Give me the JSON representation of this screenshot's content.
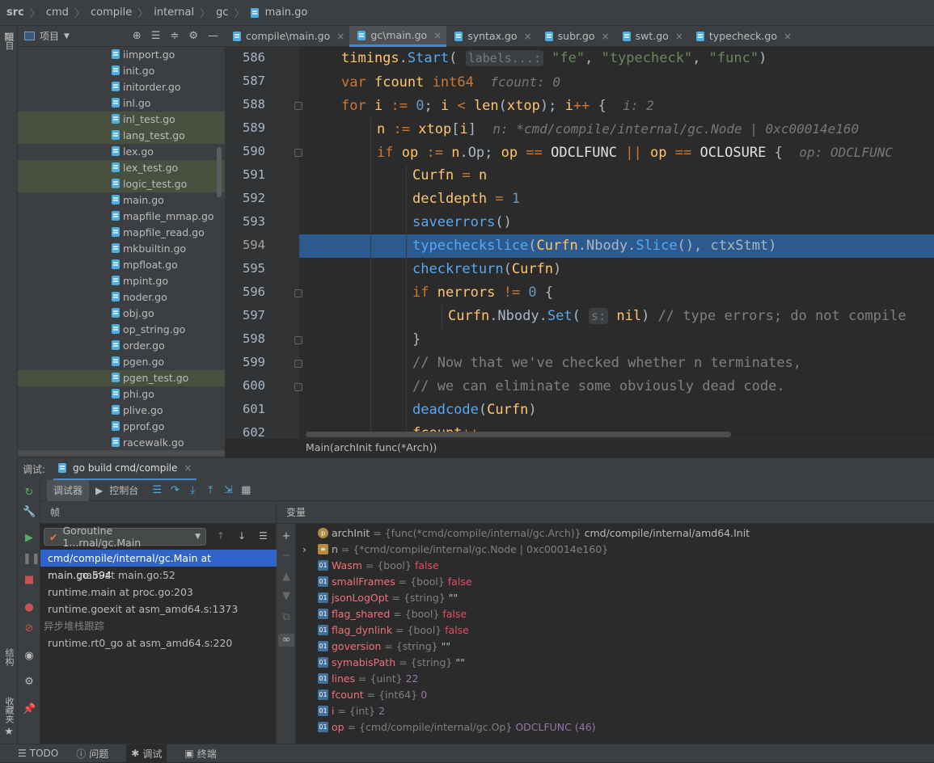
{
  "breadcrumb": [
    "src",
    "cmd",
    "compile",
    "internal",
    "gc",
    "main.go"
  ],
  "left_strip": {
    "project": "项目",
    "structure": "结构",
    "favorites": "收藏夹"
  },
  "project_panel": {
    "title": "项目",
    "files": [
      {
        "name": "iimport.go",
        "highlight": false
      },
      {
        "name": "init.go",
        "highlight": false
      },
      {
        "name": "initorder.go",
        "highlight": false
      },
      {
        "name": "inl.go",
        "highlight": false
      },
      {
        "name": "inl_test.go",
        "highlight": true
      },
      {
        "name": "lang_test.go",
        "highlight": true
      },
      {
        "name": "lex.go",
        "highlight": false
      },
      {
        "name": "lex_test.go",
        "highlight": true
      },
      {
        "name": "logic_test.go",
        "highlight": true
      },
      {
        "name": "main.go",
        "highlight": false
      },
      {
        "name": "mapfile_mmap.go",
        "highlight": false
      },
      {
        "name": "mapfile_read.go",
        "highlight": false
      },
      {
        "name": "mkbuiltin.go",
        "highlight": false
      },
      {
        "name": "mpfloat.go",
        "highlight": false
      },
      {
        "name": "mpint.go",
        "highlight": false
      },
      {
        "name": "noder.go",
        "highlight": false
      },
      {
        "name": "obj.go",
        "highlight": false
      },
      {
        "name": "op_string.go",
        "highlight": false
      },
      {
        "name": "order.go",
        "highlight": false
      },
      {
        "name": "pgen.go",
        "highlight": false
      },
      {
        "name": "pgen_test.go",
        "highlight": true
      },
      {
        "name": "phi.go",
        "highlight": false
      },
      {
        "name": "plive.go",
        "highlight": false
      },
      {
        "name": "pprof.go",
        "highlight": false
      },
      {
        "name": "racewalk.go",
        "highlight": false
      }
    ]
  },
  "tabs": [
    {
      "label": "compile\\main.go",
      "active": false
    },
    {
      "label": "gc\\main.go",
      "active": true
    },
    {
      "label": "syntax.go",
      "active": false
    },
    {
      "label": "subr.go",
      "active": false
    },
    {
      "label": "swt.go",
      "active": false
    },
    {
      "label": "typecheck.go",
      "active": false
    }
  ],
  "code": {
    "line_numbers": [
      "586",
      "587",
      "588",
      "589",
      "590",
      "591",
      "592",
      "593",
      "594",
      "595",
      "596",
      "597",
      "598",
      "599",
      "600",
      "601",
      "602"
    ],
    "current_line": "594",
    "hints": {
      "labels": "labels...:",
      "fcount": "fcount: 0",
      "i": "i: 2",
      "n": "n: *cmd/compile/internal/gc.Node | 0xc00014e160",
      "op": "op: ODCLFUNC",
      "s": "s:"
    },
    "footer": "Main(archInit func(*Arch))"
  },
  "debug": {
    "label": "调试:",
    "session": "go build cmd/compile",
    "tab_debugger": "调试器",
    "tab_console": "控制台",
    "frames_header": "帧",
    "goroutine": "Goroutine 1...rnal/gc.Main",
    "frames": [
      {
        "text": "cmd/compile/internal/gc.Main at main.go:594",
        "selected": true,
        "group": false
      },
      {
        "text": "main.main at main.go:52",
        "selected": false,
        "group": false
      },
      {
        "text": "runtime.main at proc.go:203",
        "selected": false,
        "group": false
      },
      {
        "text": "runtime.goexit at asm_amd64.s:1373",
        "selected": false,
        "group": false
      },
      {
        "text": "异步堆栈跟踪",
        "selected": false,
        "group": true
      },
      {
        "text": "runtime.rt0_go at asm_amd64.s:220",
        "selected": false,
        "group": false
      }
    ],
    "variables_header": "变量",
    "variables": [
      {
        "badge": "p",
        "name": "archInit",
        "type": "{func(*cmd/compile/internal/gc.Arch)}",
        "value": "cmd/compile/internal/amd64.Init",
        "kind": "norm",
        "expand": false
      },
      {
        "badge": "n",
        "name": "n",
        "type": "{*cmd/compile/internal/gc.Node | 0xc00014e160}",
        "value": "",
        "kind": "norm",
        "expand": true
      },
      {
        "badge": "o",
        "name": "Wasm",
        "type": "{bool}",
        "value": "false",
        "kind": "bool",
        "expand": false
      },
      {
        "badge": "o",
        "name": "smallFrames",
        "type": "{bool}",
        "value": "false",
        "kind": "bool",
        "expand": false
      },
      {
        "badge": "o",
        "name": "jsonLogOpt",
        "type": "{string}",
        "value": "\"\"",
        "kind": "str",
        "expand": false
      },
      {
        "badge": "o",
        "name": "flag_shared",
        "type": "{bool}",
        "value": "false",
        "kind": "bool",
        "expand": false
      },
      {
        "badge": "o",
        "name": "flag_dynlink",
        "type": "{bool}",
        "value": "false",
        "kind": "bool",
        "expand": false
      },
      {
        "badge": "o",
        "name": "goversion",
        "type": "{string}",
        "value": "\"\"",
        "kind": "str",
        "expand": false
      },
      {
        "badge": "o",
        "name": "symabisPath",
        "type": "{string}",
        "value": "\"\"",
        "kind": "str",
        "expand": false
      },
      {
        "badge": "o",
        "name": "lines",
        "type": "{uint}",
        "value": "22",
        "kind": "num",
        "expand": false
      },
      {
        "badge": "o",
        "name": "fcount",
        "type": "{int64}",
        "value": "0",
        "kind": "num",
        "expand": false
      },
      {
        "badge": "o",
        "name": "i",
        "type": "{int}",
        "value": "2",
        "kind": "num",
        "expand": false
      },
      {
        "badge": "o",
        "name": "op",
        "type": "{cmd/compile/internal/gc.Op}",
        "value": "ODCLFUNC (46)",
        "kind": "enum",
        "expand": false
      }
    ]
  },
  "bottom_bar": {
    "todo": "TODO",
    "problems": "问题",
    "debug": "调试",
    "terminal": "终端"
  }
}
